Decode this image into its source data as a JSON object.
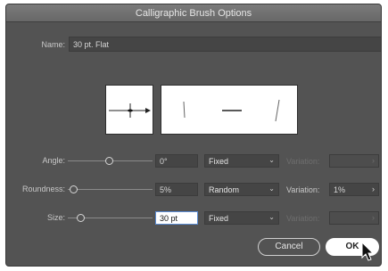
{
  "dialog": {
    "title": "Calligraphic Brush Options"
  },
  "name": {
    "label": "Name:",
    "value": "30 pt. Flat"
  },
  "angle": {
    "label": "Angle:",
    "value": "0°",
    "mode": "Fixed",
    "variation_label": "Variation:",
    "variation_value": "",
    "variation_enabled": false
  },
  "roundness": {
    "label": "Roundness:",
    "value": "5%",
    "mode": "Random",
    "variation_label": "Variation:",
    "variation_value": "1%",
    "variation_enabled": true
  },
  "size": {
    "label": "Size:",
    "value": "30 pt",
    "mode": "Fixed",
    "variation_label": "Variation:",
    "variation_value": "",
    "variation_enabled": false
  },
  "buttons": {
    "cancel": "Cancel",
    "ok": "OK"
  },
  "icons": {
    "dropdown": "chevron-down-icon",
    "stepper": "chevron-right-icon",
    "pointer": "arrow-cursor-icon"
  },
  "colors": {
    "dialog_bg": "#535353",
    "field_bg": "#454545",
    "focus": "#5b8cd4"
  }
}
